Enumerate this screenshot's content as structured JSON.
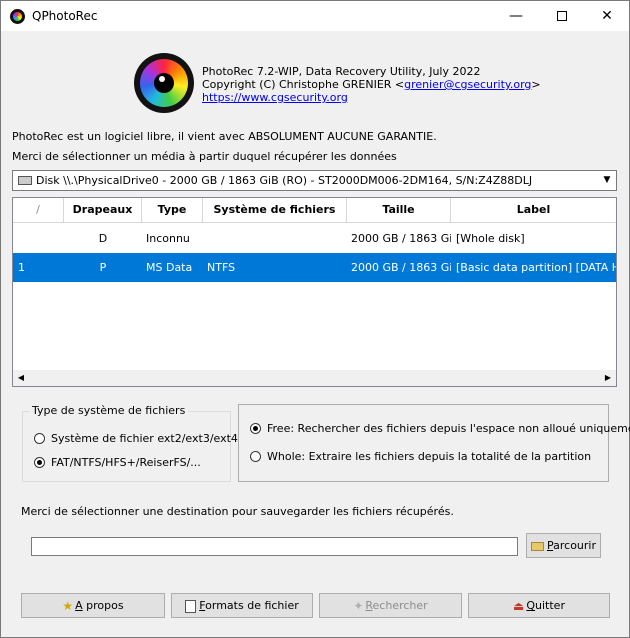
{
  "window": {
    "title": "QPhotoRec",
    "minimize_label": "—",
    "maximize_label": "",
    "close_label": "✕"
  },
  "header": {
    "version_line": "PhotoRec 7.2-WIP, Data Recovery Utility, July 2022",
    "copyright_prefix": "Copyright (C) Christophe GRENIER <",
    "email": "grenier@cgsecurity.org",
    "copyright_suffix": ">",
    "website": "https://www.cgsecurity.org"
  },
  "intro": {
    "license": "PhotoRec est un logiciel libre, il vient avec ABSOLUMENT AUCUNE GARANTIE.",
    "select_media": "Merci de sélectionner un média à partir duquel récupérer les données"
  },
  "disk_select": {
    "value": "Disk \\\\.\\PhysicalDrive0 - 2000 GB / 1863 GiB (RO) - ST2000DM006-2DM164, S/N:Z4Z88DLJ",
    "arrow": "▼"
  },
  "partition_table": {
    "columns": [
      "/",
      "Drapeaux",
      "Type",
      "Système de fichiers",
      "Taille",
      "Label"
    ],
    "rows": [
      {
        "num": "",
        "flag": "D",
        "type": "Inconnu",
        "fs": "",
        "size": "2000 GB / 1863 GiB",
        "label": "[Whole disk]"
      },
      {
        "num": "1",
        "flag": "P",
        "type": "MS Data",
        "fs": "NTFS",
        "size": "2000 GB / 1863 GiB",
        "label": "[Basic data partition] [DATA HD"
      }
    ],
    "selected_row": 1,
    "scroll_left": "◀",
    "scroll_right": "▶"
  },
  "fs_type_group": {
    "title": "Type de système de fichiers",
    "options": [
      {
        "label": "Système de fichier ext2/ext3/ext4",
        "checked": false
      },
      {
        "label": "FAT/NTFS/HFS+/ReiserFS/...",
        "checked": true
      }
    ]
  },
  "scope_group": {
    "options": [
      {
        "label": "Free: Rechercher des fichiers depuis l'espace non alloué uniquement",
        "checked": true
      },
      {
        "label": "Whole: Extraire les fichiers depuis la totalité de la partition",
        "checked": false
      }
    ]
  },
  "destination": {
    "prompt": "Merci de sélectionner une destination pour sauvegarder les fichiers récupérés.",
    "value": "",
    "browse_first": "P",
    "browse_rest": "arcourir"
  },
  "buttons": {
    "about_first": "A",
    "about_rest": " propos",
    "formats_first": "F",
    "formats_rest": "ormats de fichier",
    "search_first": "R",
    "search_rest": "echercher",
    "search_enabled": false,
    "quit_first": "Q",
    "quit_rest": "uitter"
  },
  "icons": {
    "about": "star-icon",
    "formats": "document-icon",
    "search": "search-icon",
    "quit": "exit-icon",
    "browse": "folder-icon"
  },
  "colors": {
    "selection": "#0078d7",
    "link": "#0000ee"
  }
}
